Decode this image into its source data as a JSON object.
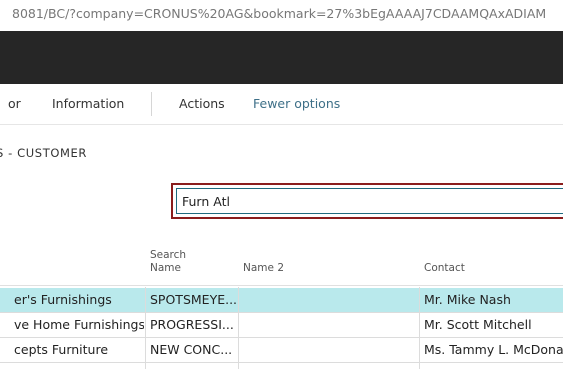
{
  "browser": {
    "url": "8081/BC/?company=CRONUS%20AG&bookmark=27%3bEgAAAAJ7CDAAMQAxADIAM"
  },
  "action_bar": {
    "items": [
      "Information",
      "Actions",
      "Fewer options"
    ],
    "partial_left": "or"
  },
  "page": {
    "title": "S - CUSTOMER"
  },
  "search": {
    "value": "Furn Atl"
  },
  "table": {
    "headers": {
      "search_name_1": "Search",
      "search_name_2": "Name",
      "name2": "Name 2",
      "contact": "Contact"
    },
    "rows": [
      {
        "name": "er's Furnishings",
        "search_name": "SPOTSMEYE...",
        "name2": "",
        "contact": "Mr. Mike Nash",
        "selected": true
      },
      {
        "name": "ve Home Furnishings",
        "search_name": "PROGRESSI...",
        "name2": "",
        "contact": "Mr. Scott Mitchell",
        "selected": false
      },
      {
        "name": "cepts Furniture",
        "search_name": "NEW CONC...",
        "name2": "",
        "contact": "Ms. Tammy L. McDonald",
        "selected": false
      }
    ]
  },
  "colors": {
    "dark_bar": "#262626",
    "highlight_border": "#8a1d1d",
    "selected_row": "#b9e9ec",
    "link": "#3e7088"
  }
}
